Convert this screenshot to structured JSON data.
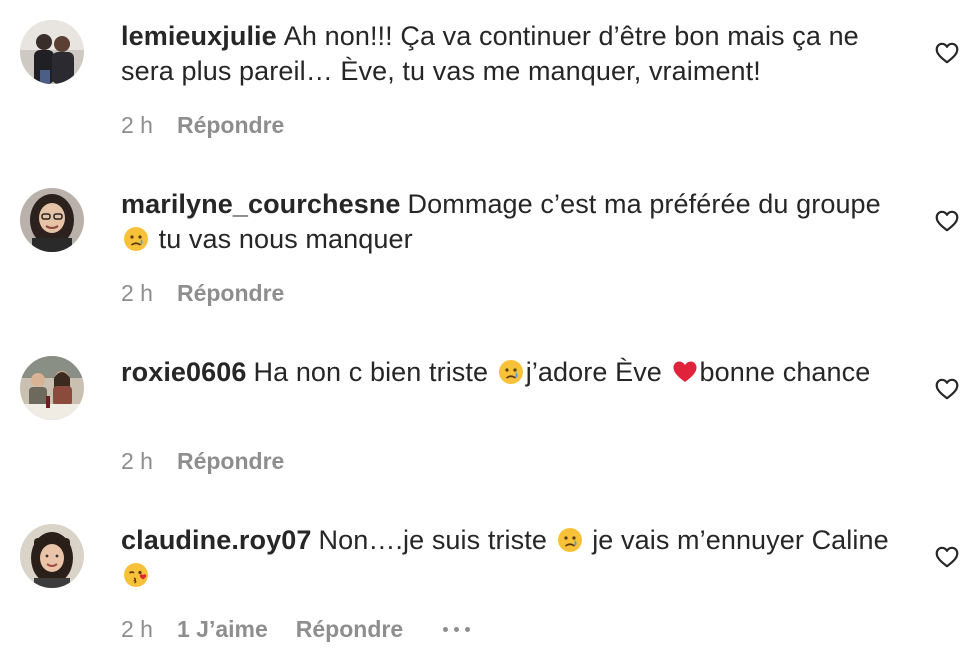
{
  "comments": [
    {
      "username": "lemieuxjulie",
      "text_parts": [
        "Ah non!!! Ça va continuer d’être bon mais ça ne sera plus pareil… Ève, tu vas me manquer, vraiment!"
      ],
      "time": "2 h",
      "reply_label": "Répondre",
      "avatar_icon": "avatar-photo-couple",
      "like_icon": "heart-outline-icon"
    },
    {
      "username": "marilyne_courchesne",
      "text_parts": [
        "Dommage c’est ma préférée du groupe",
        "tu vas nous manquer"
      ],
      "emoji": [
        "crying-face-emoji"
      ],
      "time": "2 h",
      "reply_label": "Répondre",
      "avatar_icon": "avatar-photo-woman-glasses",
      "like_icon": "heart-outline-icon"
    },
    {
      "username": "roxie0606",
      "text_parts": [
        "Ha non c bien triste",
        "j’adore Ève",
        "bonne chance"
      ],
      "emoji": [
        "crying-face-emoji",
        "red-heart-emoji"
      ],
      "time": "2 h",
      "reply_label": "Répondre",
      "avatar_icon": "avatar-photo-group",
      "like_icon": "heart-outline-icon"
    },
    {
      "username": "claudine.roy07",
      "text_parts": [
        "Non….je suis triste",
        "je vais m’ennuyer Caline"
      ],
      "emoji": [
        "crying-face-emoji",
        "face-blowing-kiss-emoji"
      ],
      "time": "2 h",
      "likes_label": "1 J’aime",
      "reply_label": "Répondre",
      "more_icon": "more-options-icon",
      "avatar_icon": "avatar-photo-woman",
      "like_icon": "heart-outline-icon"
    }
  ],
  "colors": {
    "text": "#262626",
    "secondary": "#8e8e8e",
    "heart_red": "#e0223a",
    "emoji_yellow": "#f7c23a",
    "tear_blue": "#4aa3df"
  }
}
